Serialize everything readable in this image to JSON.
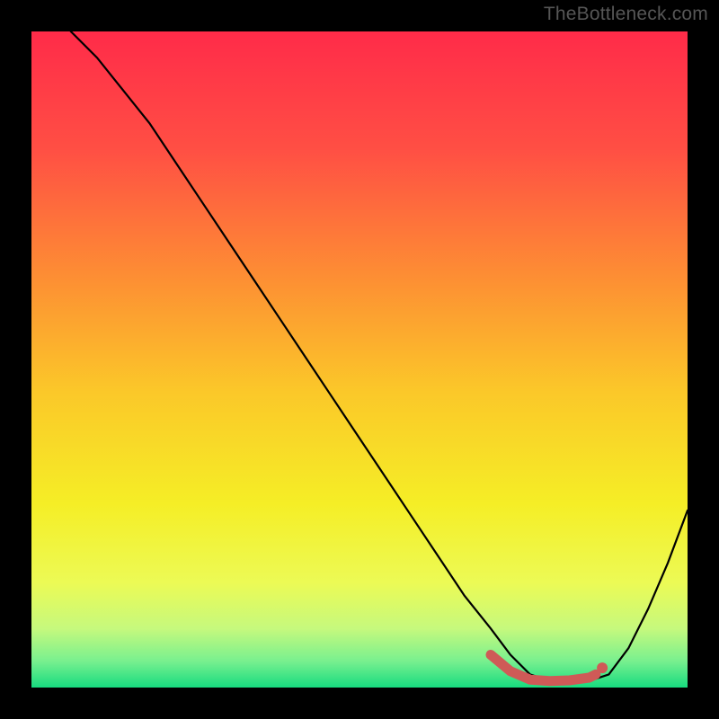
{
  "watermark": "TheBottleneck.com",
  "chart_data": {
    "type": "line",
    "title": "",
    "xlabel": "",
    "ylabel": "",
    "xlim": [
      0,
      100
    ],
    "ylim": [
      0,
      100
    ],
    "grid": false,
    "legend": false,
    "background": {
      "fill": "vertical-gradient",
      "stops": [
        {
          "pos": 0.0,
          "color": "#ff2b49"
        },
        {
          "pos": 0.18,
          "color": "#ff4f44"
        },
        {
          "pos": 0.38,
          "color": "#fd9033"
        },
        {
          "pos": 0.55,
          "color": "#fbc829"
        },
        {
          "pos": 0.72,
          "color": "#f5ee26"
        },
        {
          "pos": 0.84,
          "color": "#ecfa55"
        },
        {
          "pos": 0.91,
          "color": "#c6f97d"
        },
        {
          "pos": 0.96,
          "color": "#78f08f"
        },
        {
          "pos": 1.0,
          "color": "#17db7f"
        }
      ]
    },
    "series": [
      {
        "name": "bottleneck-curve",
        "color": "#000000",
        "x": [
          6,
          10,
          14,
          18,
          22,
          26,
          30,
          34,
          38,
          42,
          46,
          50,
          54,
          58,
          62,
          66,
          70,
          73,
          76,
          79,
          82,
          85,
          88,
          91,
          94,
          97,
          100
        ],
        "y": [
          100,
          96,
          91,
          86,
          80,
          74,
          68,
          62,
          56,
          50,
          44,
          38,
          32,
          26,
          20,
          14,
          9,
          5,
          2,
          1,
          1,
          1,
          2,
          6,
          12,
          19,
          27
        ]
      }
    ],
    "highlight": {
      "name": "optimal-range",
      "color": "#cf5a57",
      "x": [
        70,
        73,
        76,
        79,
        82,
        85,
        86
      ],
      "y": [
        5,
        2.5,
        1.2,
        1,
        1.1,
        1.5,
        2
      ],
      "end_dot": {
        "x": 87,
        "y": 3
      }
    }
  }
}
